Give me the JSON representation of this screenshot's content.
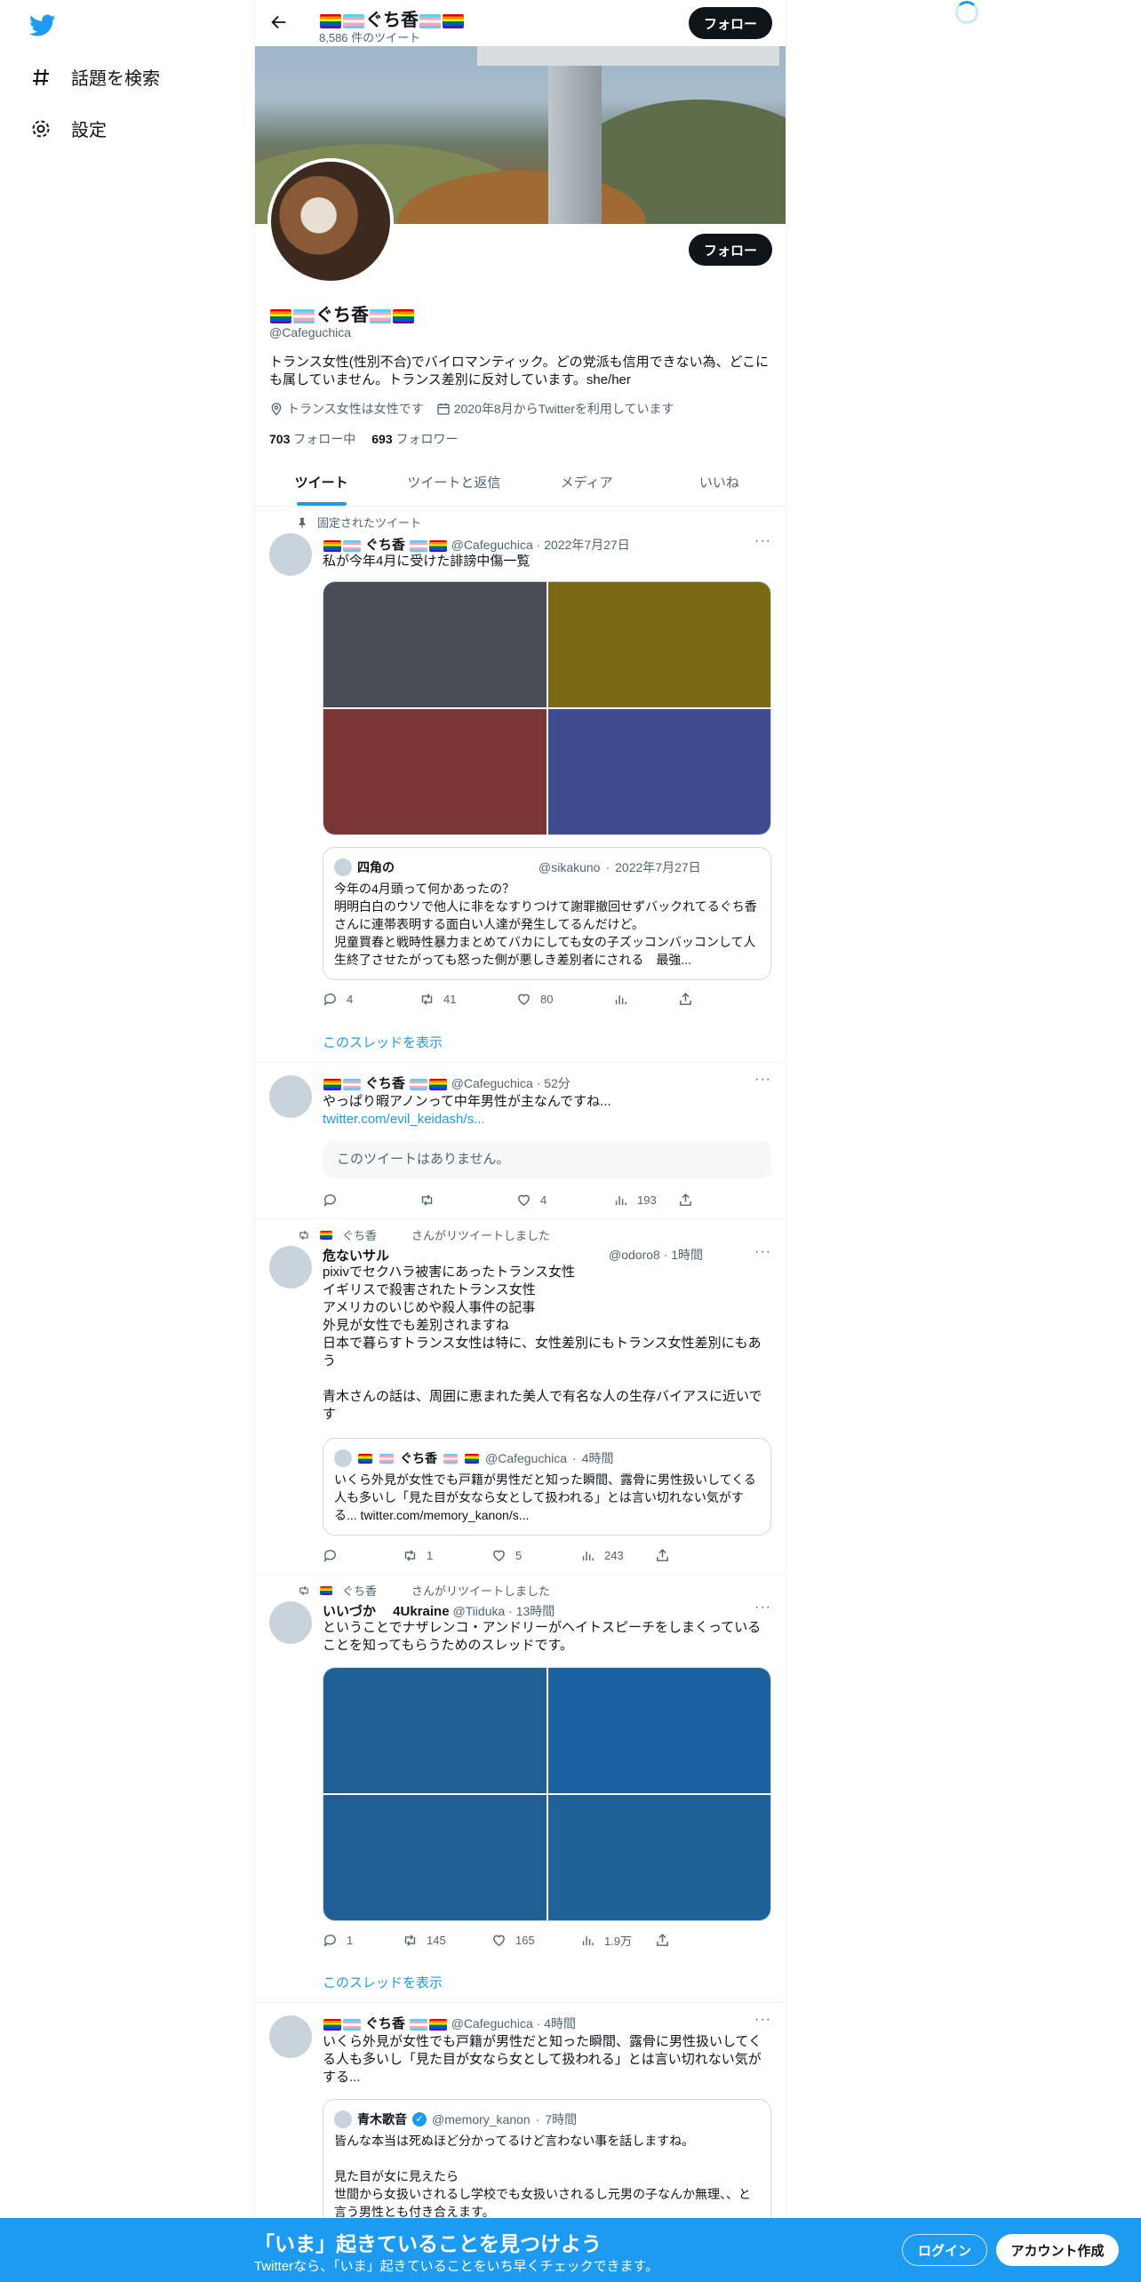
{
  "nav": {
    "items": [
      {
        "label": "話題を検索",
        "icon": "hashtag-icon"
      },
      {
        "label": "設定",
        "icon": "gear-icon"
      }
    ]
  },
  "header": {
    "name": "ぐち香",
    "tweet_count": "8,586 件のツイート",
    "follow_label": "フォロー"
  },
  "profile": {
    "name": "ぐち香",
    "handle": "@Cafeguchica",
    "bio": "トランス女性(性別不合)でバイロマンティック。どの党派も信用できない為、どこにも属していません。トランス差別に反対しています。she/her",
    "location": "トランス女性は女性です",
    "joined": "2020年8月からTwitterを利用しています",
    "following_count": "703",
    "following_label": "フォロー中",
    "followers_count": "693",
    "followers_label": "フォロワー",
    "follow_label": "フォロー"
  },
  "tabs": [
    "ツイート",
    "ツイートと返信",
    "メディア",
    "いいね"
  ],
  "tweets": [
    {
      "context": "固定されたツイート",
      "name": "ぐち香",
      "handle": "@Cafeguchica",
      "time": "2022年7月27日",
      "text": "私が今年4月に受けた誹謗中傷一覧",
      "image_colors": [
        "#474c55",
        "#7a6a14",
        "#7a3535",
        "#3f4c90"
      ],
      "quote": {
        "name": "四角の",
        "handle": "@sikakuno",
        "time": "2022年7月27日",
        "text": "今年の4月頭って何かあったの？\n明明白白のウソで他人に非をなすりつけて謝罪撤回せずバックれてるぐち香さんに連帯表明する面白い人達が発生してるんだけど。\n児童買春と戦時性暴力まとめてバカにしても女の子ズッコンバッコンして人生終了させたがっても怒った側が悪しき差別者にされる　最強..."
      },
      "replies": "4",
      "retweets": "41",
      "likes": "80",
      "show_thread": "このスレッドを表示"
    },
    {
      "name": "ぐち香",
      "handle": "@Cafeguchica",
      "time": "52分",
      "text": "やっぱり暇アノンって中年男性が主なんですね...",
      "link": "twitter.com/evil_keidash/s...",
      "unavailable": "このツイートはありません。",
      "replies": "",
      "retweets": "",
      "likes": "4",
      "views": "193"
    },
    {
      "context": "ぐち香　　　さんがリツイートしました",
      "name": "危ないサル",
      "handle": "@odoro8",
      "time": "1時間",
      "text": "pixivでセクハラ被害にあったトランス女性\nイギリスで殺害されたトランス女性\nアメリカのいじめや殺人事件の記事\n外見が女性でも差別されますね\n日本で暮らすトランス女性は特に、女性差別にもトランス女性差別にもあう\n\n青木さんの話は、周囲に恵まれた美人で有名な人の生存バイアスに近いです",
      "quote": {
        "name": "ぐち香",
        "handle": "@Cafeguchica",
        "time": "4時間",
        "text": "いくら外見が女性でも戸籍が男性だと知った瞬間、露骨に男性扱いしてくる人も多いし「見た目が女なら女として扱われる」とは言い切れない気がする... twitter.com/memory_kanon/s..."
      },
      "replies": "",
      "retweets": "1",
      "likes": "5",
      "views": "243"
    },
    {
      "context": "ぐち香　　　さんがリツイートしました",
      "name": "いいづか　 4Ukraine",
      "handle": "@Tiiduka",
      "time": "13時間",
      "text": "ということでナザレンコ・アンドリーがヘイトスピーチをしまくっていることを知ってもらうためのスレッドです。",
      "image_colors": [
        "#1e5f94",
        "#1c62a0",
        "#1f5f93",
        "#1d6299"
      ],
      "replies": "1",
      "retweets": "145",
      "likes": "165",
      "views": "1.9万",
      "show_thread": "このスレッドを表示"
    },
    {
      "name": "ぐち香",
      "handle": "@Cafeguchica",
      "time": "4時間",
      "text": "いくら外見が女性でも戸籍が男性だと知った瞬間、露骨に男性扱いしてくる人も多いし「見た目が女なら女として扱われる」とは言い切れない気がする...",
      "quote": {
        "name": "青木歌音",
        "handle": "@memory_kanon",
        "time": "7時間",
        "text": "皆んな本当は死ぬほど分かってるけど言わない事を話しますね。\n\n見た目が女に見えたら\n世間から女扱いされるし学校でも女扱いされるし元男の子なんか無理、、と言う男性とも付き合えます。"
      }
    }
  ],
  "bottom_bar": {
    "title": "「いま」起きていることを見つけよう",
    "subtitle": "Twitterなら、「いま」起きていることをいち早くチェックできます。",
    "login": "ログイン",
    "signup": "アカウント作成"
  }
}
